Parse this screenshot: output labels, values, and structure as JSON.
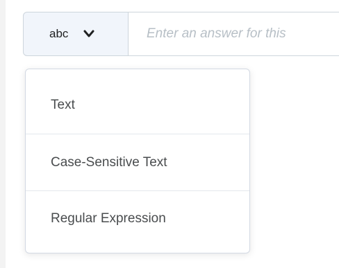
{
  "answer_field": {
    "type_selected": "abc",
    "input_placeholder": "Enter an answer for this",
    "input_value": ""
  },
  "type_menu": {
    "items": [
      {
        "label": "Text"
      },
      {
        "label": "Case-Sensitive Text"
      },
      {
        "label": "Regular Expression"
      }
    ]
  },
  "icons": {
    "type_select_chevron": "chevron-down-icon"
  },
  "colors": {
    "page_background": "#f3f3f3",
    "select_background": "#f1f5fb",
    "border": "#cdd5dc",
    "placeholder": "#b7bfc6",
    "menu_text": "#494c4e"
  }
}
